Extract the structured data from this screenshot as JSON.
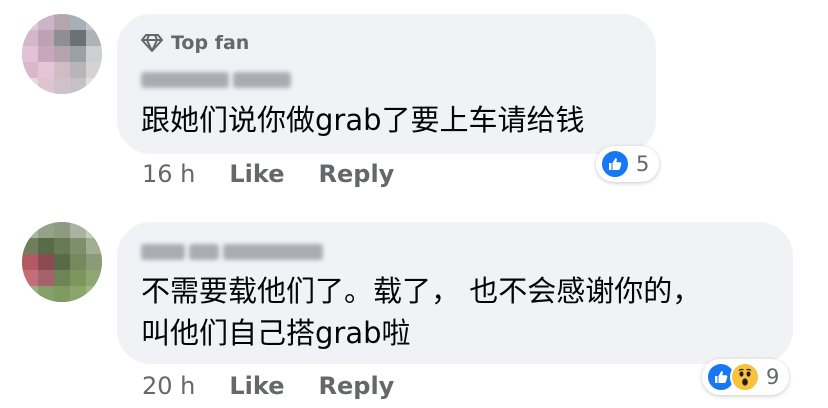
{
  "comments": [
    {
      "badge": "Top fan",
      "author_hidden": true,
      "text": "跟她们说你做grab了要上车请给钱",
      "time": "16 h",
      "like_label": "Like",
      "reply_label": "Reply",
      "reaction_count": "5",
      "reactions": [
        "like"
      ]
    },
    {
      "author_hidden": true,
      "text_lines": [
        "不需要载他们了。载了， 也不会感谢你的，",
        "叫他们自己搭grab啦"
      ],
      "time": "20 h",
      "like_label": "Like",
      "reply_label": "Reply",
      "reaction_count": "9",
      "reactions": [
        "like",
        "wow"
      ]
    }
  ],
  "colors": {
    "bubble": "#f0f2f5",
    "secondary_text": "#65676b",
    "like_blue": "#1877f2",
    "wow_yellow": "#f7c23d"
  }
}
